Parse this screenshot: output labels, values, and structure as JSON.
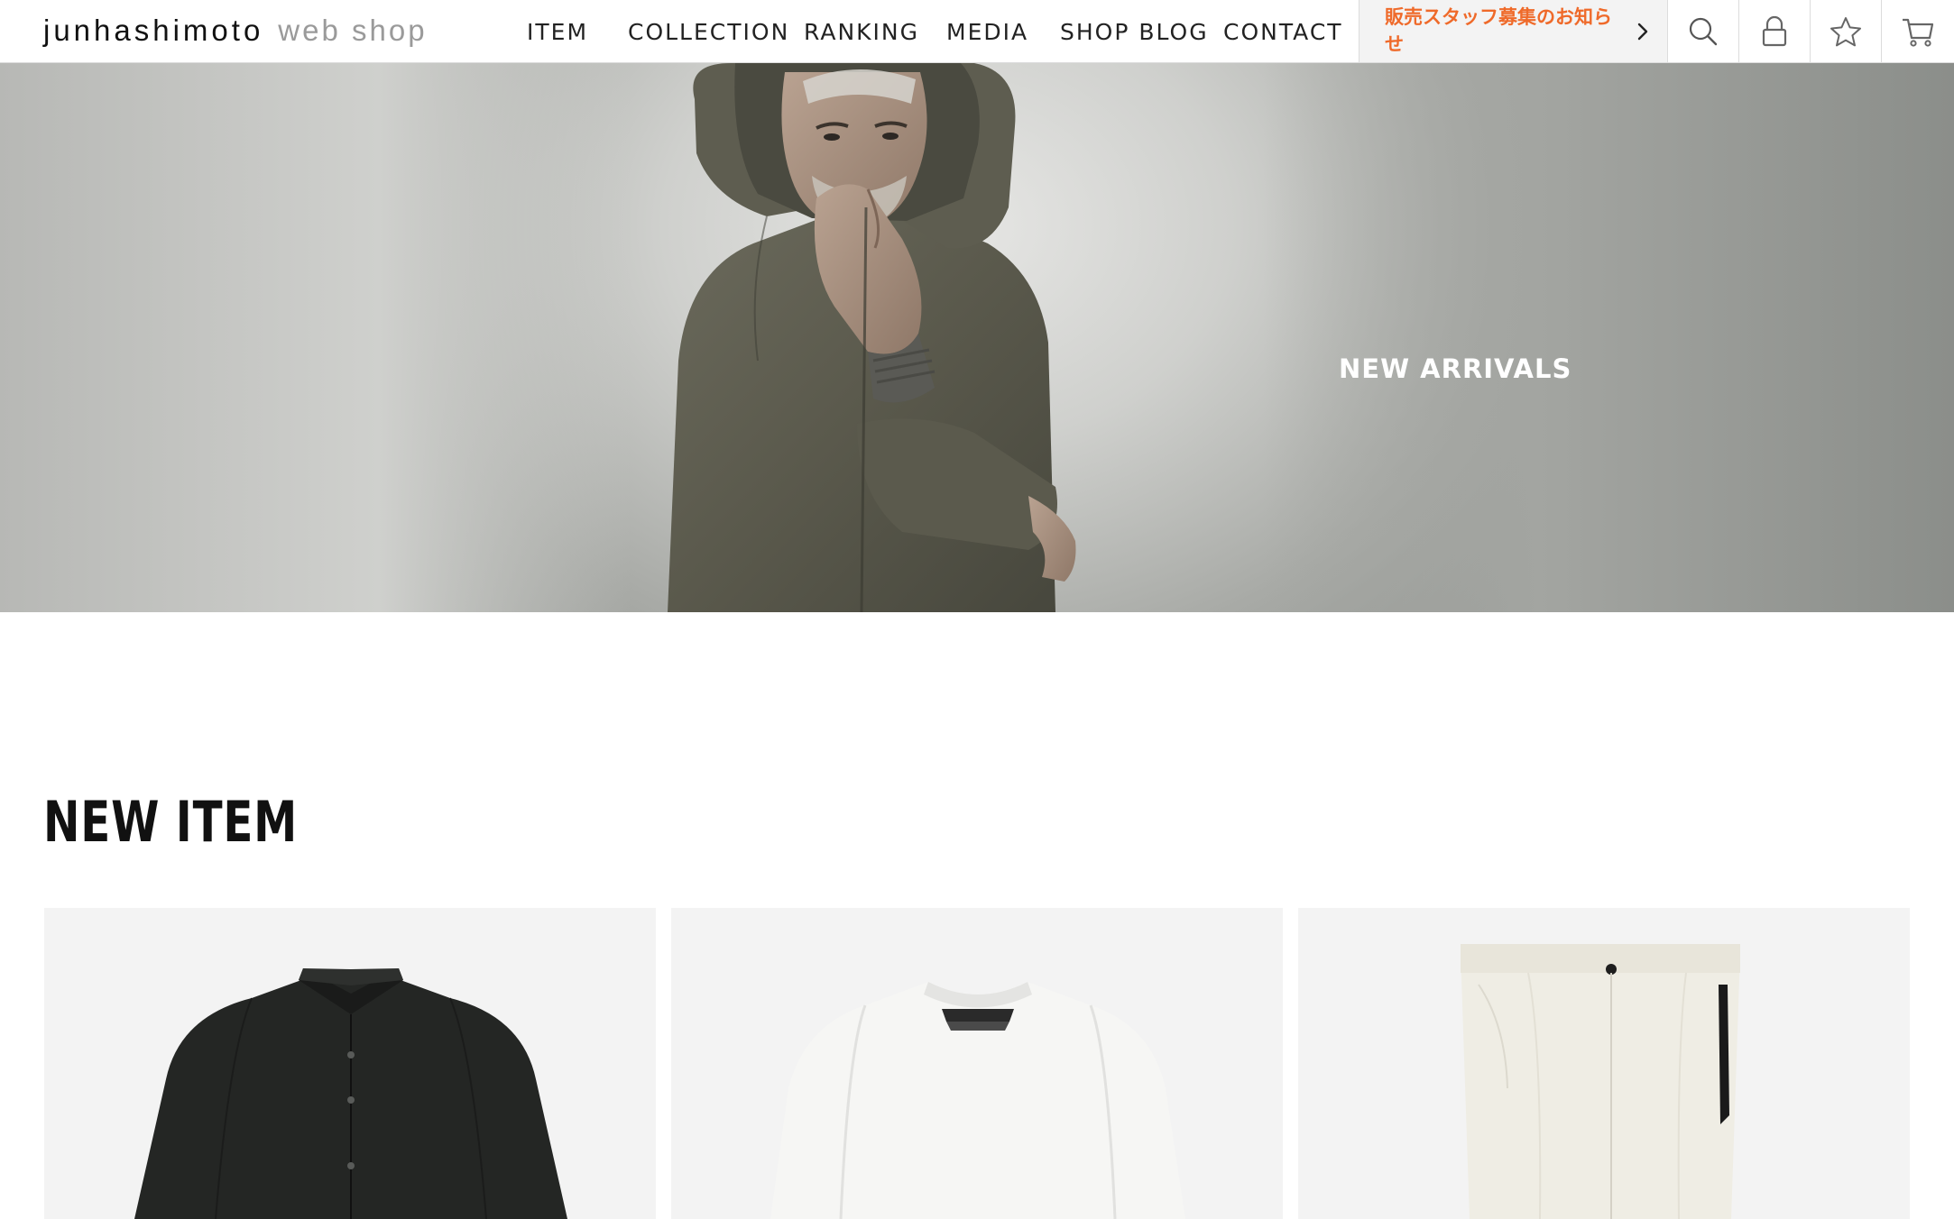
{
  "header": {
    "logo_main": "junhashimoto",
    "logo_sub": "web shop",
    "nav": [
      {
        "label": "ITEM"
      },
      {
        "label": "COLLECTION"
      },
      {
        "label": "RANKING"
      },
      {
        "label": "MEDIA"
      },
      {
        "label": "SHOP BLOG"
      },
      {
        "label": "CONTACT"
      }
    ],
    "notice": "販売スタッフ募集のお知らせ",
    "icons": [
      "search-icon",
      "lock-icon",
      "star-icon",
      "cart-icon"
    ]
  },
  "hero": {
    "title": "NEW ARRIVALS"
  },
  "new_item": {
    "title": "NEW ITEM",
    "products": [
      {
        "kind": "shirt",
        "color": "#232523"
      },
      {
        "kind": "tshirt",
        "color": "#f4f4f2"
      },
      {
        "kind": "pants",
        "color": "#efece2"
      }
    ]
  },
  "colors": {
    "accent": "#ef6a2a",
    "card_bg": "#f3f3f3"
  }
}
